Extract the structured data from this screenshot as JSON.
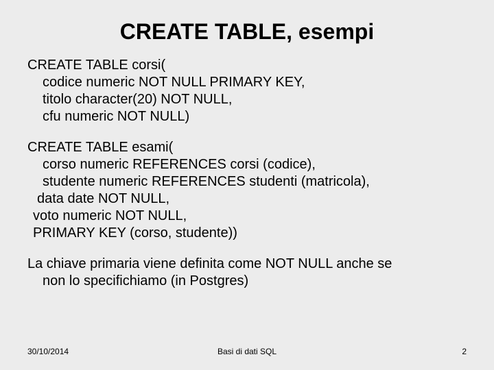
{
  "title": "CREATE TABLE, esempi",
  "block1": {
    "l1": "CREATE TABLE corsi(",
    "l2": "codice numeric NOT NULL PRIMARY KEY,",
    "l3": "titolo character(20) NOT NULL,",
    "l4": "cfu numeric NOT NULL)"
  },
  "block2": {
    "l1": "CREATE TABLE esami(",
    "l2": "corso numeric REFERENCES corsi (codice),",
    "l3": "studente numeric REFERENCES studenti (matricola),",
    "l4": "data date NOT NULL,",
    "l5": "voto numeric NOT NULL,",
    "l6": "PRIMARY KEY (corso, studente))"
  },
  "note": {
    "l1": "La chiave primaria viene definita come NOT NULL anche se",
    "l2": "non lo specifichiamo (in Postgres)"
  },
  "footer": {
    "date": "30/10/2014",
    "center": "Basi di dati  SQL",
    "page": "2"
  }
}
